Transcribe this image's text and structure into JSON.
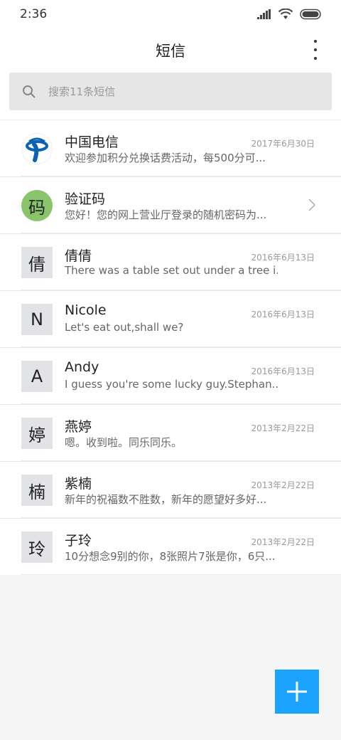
{
  "status": {
    "time": "2:36"
  },
  "header": {
    "title": "短信"
  },
  "search": {
    "placeholder": "搜索11条短信"
  },
  "conversations": [
    {
      "name": "中国电信",
      "snippet": "欢迎参加积分兑换话费活动，每500分可...",
      "date": "2017年6月30日",
      "avatar": "telecom-logo"
    },
    {
      "name": "验证码",
      "snippet": "您好！您的网上营业厅登录的随机密码为...",
      "date": "",
      "avatar": "码"
    },
    {
      "name": "倩倩",
      "snippet": "There was a table set out under a tree i...",
      "date": "2016年6月13日",
      "avatar": "倩"
    },
    {
      "name": "Nicole",
      "snippet": "Let's eat out,shall we?",
      "date": "2016年6月13日",
      "avatar": "N"
    },
    {
      "name": "Andy",
      "snippet": "I guess you're some lucky guy.Stephan...",
      "date": "2016年6月13日",
      "avatar": "A"
    },
    {
      "name": "燕婷",
      "snippet": "嗯。收到啦。同乐同乐。",
      "date": "2013年2月22日",
      "avatar": "婷"
    },
    {
      "name": "紫楠",
      "snippet": "新年的祝福数不胜数，新年的愿望好多好...",
      "date": "2013年2月22日",
      "avatar": "楠"
    },
    {
      "name": "子玲",
      "snippet": "10分想念9别的你，8张照片7张是你，6只...",
      "date": "2013年2月22日",
      "avatar": "玲"
    }
  ],
  "colors": {
    "accent": "#1aa3ff",
    "verify_avatar": "#8ac46a",
    "telecom_blue": "#0a62b5"
  }
}
